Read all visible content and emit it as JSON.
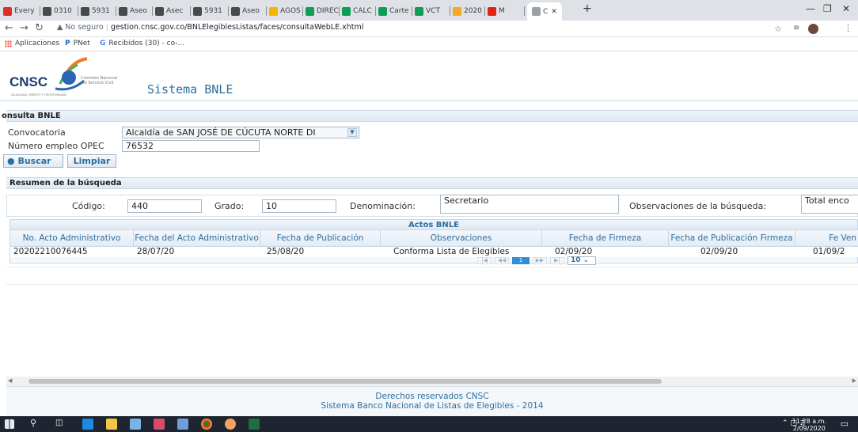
{
  "browser": {
    "tabs": [
      {
        "label": "Every",
        "icon": "gmail-icon",
        "color": "#d93025"
      },
      {
        "label": "0310",
        "icon": "cnsc-icon",
        "color": "#4a4a4a"
      },
      {
        "label": "5931",
        "icon": "cnsc-icon",
        "color": "#4a4a4a"
      },
      {
        "label": "Aseo",
        "icon": "cnsc-icon",
        "color": "#4a4a4a"
      },
      {
        "label": "Asec",
        "icon": "cnsc-icon",
        "color": "#4a4a4a"
      },
      {
        "label": "5931",
        "icon": "cnsc-icon",
        "color": "#4a4a4a"
      },
      {
        "label": "Aseo",
        "icon": "cnsc-icon",
        "color": "#4a4a4a"
      },
      {
        "label": "AGOS",
        "icon": "drive-icon",
        "color": "#f4b400"
      },
      {
        "label": "DIREC",
        "icon": "sheets-icon",
        "color": "#0f9d58"
      },
      {
        "label": "CALC",
        "icon": "sheets-icon",
        "color": "#0f9d58"
      },
      {
        "label": "Carte",
        "icon": "sheets-icon",
        "color": "#0f9d58"
      },
      {
        "label": "VCT",
        "icon": "sheets-icon",
        "color": "#0f9d58"
      },
      {
        "label": "2020",
        "icon": "yellow-icon",
        "color": "#f9a825"
      },
      {
        "label": "M",
        "icon": "youtube-icon",
        "color": "#e62117"
      },
      {
        "label": "C",
        "icon": "page-icon",
        "color": "#9aa0a6"
      }
    ],
    "url_warning": "No seguro",
    "url": "gestion.cnsc.gov.co/BNLElegiblesListas/faces/consultaWebLE.xhtml",
    "bookmarks": [
      {
        "label": "Aplicaciones",
        "icon": "apps-grid-icon"
      },
      {
        "label": "PNet",
        "icon": "pnet-icon"
      },
      {
        "label": "Recibidos (30) - co-...",
        "icon": "google-icon"
      }
    ]
  },
  "header": {
    "logo_text": "CNSC",
    "logo_sub1": "Comisión Nacional",
    "logo_sub2": "del Servicio Civil",
    "logo_tagline": "IGUALDAD, MÉRITO Y OPORTUNIDAD",
    "app_title": "Sistema BNLE"
  },
  "consulta": {
    "title": "onsulta BNLE",
    "convocatoria_label": "Convocatoria",
    "convocatoria_value": "Alcaldía de SAN JOSÉ DE CÚCUTA NORTE DI",
    "opec_label": "Número empleo OPEC",
    "opec_value": "76532",
    "buscar_label": "Buscar",
    "limpiar_label": "Limpiar"
  },
  "resumen": {
    "title": "Resumen de la búsqueda",
    "codigo_label": "Código:",
    "codigo_value": "440",
    "grado_label": "Grado:",
    "grado_value": "10",
    "denominacion_label": "Denominación:",
    "denominacion_value": "Secretario",
    "observaciones_label": "Observaciones de la búsqueda:",
    "observaciones_value": "Total enco"
  },
  "table": {
    "caption": "Actos BNLE",
    "headers": [
      "No. Acto Administrativo",
      "Fecha del Acto Administrativo",
      "Fecha de Publicación",
      "Observaciones",
      "Fecha de Firmeza",
      "Fecha de Publicación Firmeza",
      "Fe Ven"
    ],
    "rows": [
      [
        "20202210076445",
        "28/07/20",
        "25/08/20",
        "Conforma Lista de Elegibles",
        "02/09/20",
        "02/09/20",
        "01/09/2"
      ]
    ],
    "pager": {
      "current_page": "1",
      "rows_per_page": "10"
    }
  },
  "footer": {
    "line1": "Derechos reservados CNSC",
    "line2": "Sistema Banco Nacional de Listas de Elegibles - 2014"
  },
  "taskbar": {
    "time": "11:28 a.m.",
    "date": "2/09/2020"
  }
}
